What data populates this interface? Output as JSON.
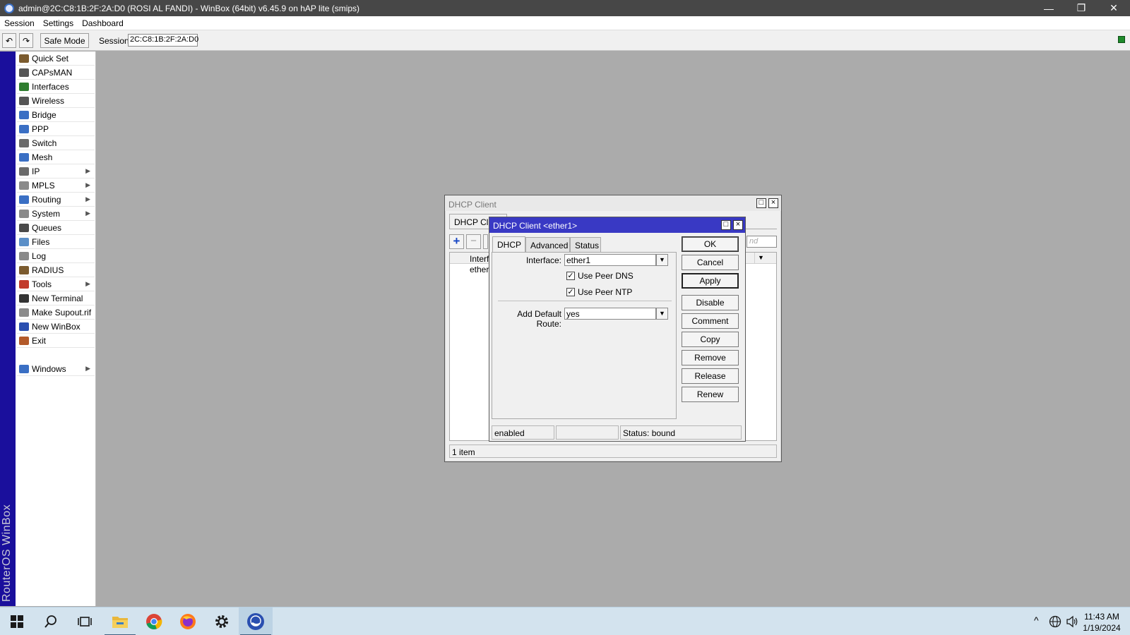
{
  "window": {
    "title": "admin@2C:C8:1B:2F:2A:D0 (ROSI AL FANDI) - WinBox (64bit) v6.45.9 on hAP lite (smips)",
    "minimize": "—",
    "restore": "❐",
    "close": "✕"
  },
  "menu": [
    "Session",
    "Settings",
    "Dashboard"
  ],
  "toolbar": {
    "undo_icon": "↶",
    "redo_icon": "↷",
    "safe_mode": "Safe Mode",
    "session_label": "Session:",
    "session_value": "2C:C8:1B:2F:2A:D0"
  },
  "brand": "RouterOS WinBox",
  "sidebar": {
    "items": [
      {
        "label": "Quick Set",
        "submenu": false,
        "icon": "quick-set-icon",
        "color": "#7b5b2e"
      },
      {
        "label": "CAPsMAN",
        "submenu": false,
        "icon": "capsman-icon",
        "color": "#555555"
      },
      {
        "label": "Interfaces",
        "submenu": false,
        "icon": "interfaces-icon",
        "color": "#2f7d2f"
      },
      {
        "label": "Wireless",
        "submenu": false,
        "icon": "wireless-icon",
        "color": "#555555"
      },
      {
        "label": "Bridge",
        "submenu": false,
        "icon": "bridge-icon",
        "color": "#3a6fc4"
      },
      {
        "label": "PPP",
        "submenu": false,
        "icon": "ppp-icon",
        "color": "#3a6fc4"
      },
      {
        "label": "Switch",
        "submenu": false,
        "icon": "switch-icon",
        "color": "#6a6a6a"
      },
      {
        "label": "Mesh",
        "submenu": false,
        "icon": "mesh-icon",
        "color": "#3a6fc4"
      },
      {
        "label": "IP",
        "submenu": true,
        "icon": "ip-icon",
        "color": "#6a6a6a"
      },
      {
        "label": "MPLS",
        "submenu": true,
        "icon": "mpls-icon",
        "color": "#8a8a8a"
      },
      {
        "label": "Routing",
        "submenu": true,
        "icon": "routing-icon",
        "color": "#3a6fc4"
      },
      {
        "label": "System",
        "submenu": true,
        "icon": "system-icon",
        "color": "#8a8a8a"
      },
      {
        "label": "Queues",
        "submenu": false,
        "icon": "queues-icon",
        "color": "#4a4a4a"
      },
      {
        "label": "Files",
        "submenu": false,
        "icon": "files-icon",
        "color": "#5b8fc8"
      },
      {
        "label": "Log",
        "submenu": false,
        "icon": "log-icon",
        "color": "#8a8a8a"
      },
      {
        "label": "RADIUS",
        "submenu": false,
        "icon": "radius-icon",
        "color": "#7b5b2e"
      },
      {
        "label": "Tools",
        "submenu": true,
        "icon": "tools-icon",
        "color": "#c23b2b"
      },
      {
        "label": "New Terminal",
        "submenu": false,
        "icon": "terminal-icon",
        "color": "#333333"
      },
      {
        "label": "Make Supout.rif",
        "submenu": false,
        "icon": "supout-icon",
        "color": "#8a8a8a"
      },
      {
        "label": "New WinBox",
        "submenu": false,
        "icon": "winbox-icon",
        "color": "#2a4fb0"
      },
      {
        "label": "Exit",
        "submenu": false,
        "icon": "exit-icon",
        "color": "#b35a2a"
      }
    ],
    "windows": {
      "label": "Windows",
      "submenu": true,
      "icon": "windows-icon",
      "color": "#3a6fc4"
    }
  },
  "dhcp_window": {
    "title": "DHCP Client",
    "tab": "DHCP Clie",
    "add_icon": "+",
    "remove_icon": "−",
    "column_header": "Interfa",
    "row": "ether1",
    "find_placeholder": "nd",
    "footer": "1 item"
  },
  "dialog": {
    "title": "DHCP Client <ether1>",
    "tabs": [
      "DHCP",
      "Advanced",
      "Status"
    ],
    "interface_label": "Interface:",
    "interface_value": "ether1",
    "use_peer_dns": "Use Peer DNS",
    "use_peer_ntp": "Use Peer NTP",
    "default_route_label": "Add Default Route:",
    "default_route_value": "yes",
    "buttons": [
      "OK",
      "Cancel",
      "Apply",
      "Disable",
      "Comment",
      "Copy",
      "Remove",
      "Release",
      "Renew"
    ],
    "status_left": "enabled",
    "status_middle": "",
    "status_right": "Status: bound"
  },
  "taskbar": {
    "time": "11:43 AM",
    "date": "1/19/2024",
    "tray_up": "^"
  }
}
